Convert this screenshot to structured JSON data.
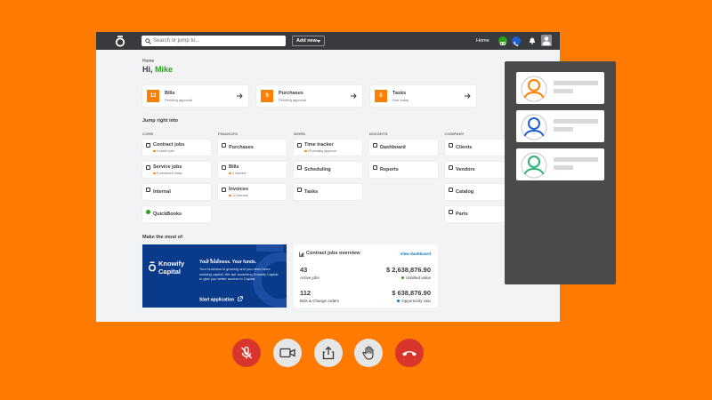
{
  "topbar": {
    "search_placeholder": "Search or jump to...",
    "add_new": "Add new",
    "home": "Home"
  },
  "breadcrumb": "Home",
  "greeting": {
    "prefix": "Hi, ",
    "name": "Mike"
  },
  "tasks": [
    {
      "count": "12",
      "title": "Bills",
      "subtitle": "Pending approval"
    },
    {
      "count": "9",
      "title": "Purchases",
      "subtitle": "Pending approval"
    },
    {
      "count": "5",
      "title": "Tasks",
      "subtitle": "Due today"
    }
  ],
  "jump_heading": "Jump right into",
  "columns": [
    {
      "heading": "CORE",
      "items": [
        {
          "label": "Contract jobs",
          "sub": "3 active jobs",
          "dot": "#ff8000"
        },
        {
          "label": "Service jobs",
          "sub": "5 scheduled today",
          "dot": "#ff8000"
        },
        {
          "label": "Internal",
          "sub": ""
        },
        {
          "label": "QuickBooks",
          "sub": ""
        }
      ]
    },
    {
      "heading": "FINANCES",
      "items": [
        {
          "label": "Purchases",
          "sub": ""
        },
        {
          "label": "Bills",
          "sub": "3 overdue",
          "dot": "#ff8000"
        },
        {
          "label": "Invoices",
          "sub": "12 overdue",
          "dot": "#ff8000"
        }
      ]
    },
    {
      "heading": "WORK",
      "items": [
        {
          "label": "Time tracker",
          "sub": "25 pending approval",
          "dot": "#ff8000"
        },
        {
          "label": "Scheduling",
          "sub": ""
        },
        {
          "label": "Tasks",
          "sub": ""
        }
      ]
    },
    {
      "heading": "INSIGHTS",
      "items": [
        {
          "label": "Dashboard",
          "sub": ""
        },
        {
          "label": "Reports",
          "sub": ""
        }
      ]
    },
    {
      "heading": "COMPANY",
      "items": [
        {
          "label": "Clients",
          "sub": ""
        },
        {
          "label": "Vendors",
          "sub": ""
        },
        {
          "label": "Catalog",
          "sub": ""
        },
        {
          "label": "Parts",
          "sub": ""
        }
      ]
    }
  ],
  "make_most_heading": "Make the most of",
  "banner": {
    "brand": "Knowify Capital",
    "headline": "Your business. Your funds.",
    "body": "Your business is growing and you need more working capital. We are launching Knowify Capital to give you better access to Capital.",
    "cta": "Start application"
  },
  "overview": {
    "title": "Contract jobs overview",
    "link": "View dashboard",
    "stats": [
      {
        "value": "43",
        "label": "Active jobs"
      },
      {
        "value": "$ 2,638,876.90",
        "label": "Unbilled value",
        "dot": "#2ca01c"
      },
      {
        "value": "112",
        "label": "Bids & Change orders"
      },
      {
        "value": "$ 638,876.90",
        "label": "Opportunity valu",
        "dot": "#0077c5"
      }
    ]
  },
  "participants": [
    {
      "avatar_color": "#ff8000",
      "icon": "person-icon"
    },
    {
      "avatar_color": "#1f5fd1",
      "icon": "person-icon"
    },
    {
      "avatar_color": "#2fb07a",
      "icon": "person-icon"
    }
  ],
  "colors": {
    "background": "#ff7a00",
    "topbar": "#393a3d",
    "accent_green": "#2ca01c",
    "accent_orange": "#ff8000",
    "link_blue": "#0077c5",
    "end_call": "#d8352c"
  }
}
